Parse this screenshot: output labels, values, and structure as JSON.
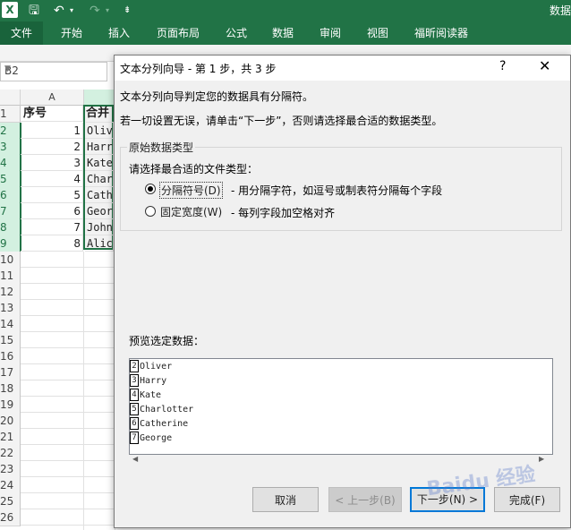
{
  "app": {
    "title_partial": "数据"
  },
  "ribbon": {
    "tabs": [
      "文件",
      "开始",
      "插入",
      "页面布局",
      "公式",
      "数据",
      "审阅",
      "视图",
      "福昕阅读器"
    ]
  },
  "name_box": {
    "value": "B2"
  },
  "sheet": {
    "columns": [
      "A"
    ],
    "row_numbers": [
      "1",
      "2",
      "3",
      "4",
      "5",
      "6",
      "7",
      "8",
      "9",
      "10",
      "11",
      "12",
      "13",
      "14",
      "15",
      "16",
      "17",
      "18",
      "19",
      "20",
      "21",
      "22",
      "23",
      "24",
      "25",
      "26"
    ],
    "header_a": "序号",
    "header_b": "合并",
    "col_a": [
      "1",
      "2",
      "3",
      "4",
      "5",
      "6",
      "7",
      "8"
    ],
    "col_b": [
      "Oliv",
      "Harr",
      "Kate",
      "Char",
      "Cath",
      "Geor",
      "John",
      "Alic"
    ]
  },
  "dialog": {
    "title": "文本分列向导 - 第 1 步，共 3 步",
    "help": "?",
    "close": "✕",
    "intro": "文本分列向导判定您的数据具有分隔符。",
    "hint": "若一切设置无误，请单击“下一步”，否则请选择最合适的数据类型。",
    "group_label": "原始数据类型",
    "prompt": "请选择最合适的文件类型：",
    "options": [
      {
        "label": "分隔符号(D)",
        "desc": "- 用分隔字符，如逗号或制表符分隔每个字段",
        "selected": true
      },
      {
        "label": "固定宽度(W)",
        "desc": "- 每列字段加空格对齐",
        "selected": false
      }
    ],
    "preview_label": "预览选定数据：",
    "preview_rows": [
      {
        "n": "2",
        "text": "Oliver"
      },
      {
        "n": "3",
        "text": "Harry"
      },
      {
        "n": "4",
        "text": "Kate"
      },
      {
        "n": "5",
        "text": "Charlotter"
      },
      {
        "n": "6",
        "text": "Catherine"
      },
      {
        "n": "7",
        "text": "George"
      }
    ],
    "buttons": {
      "cancel": "取消",
      "back": "< 上一步(B)",
      "next": "下一步(N) >",
      "finish": "完成(F)"
    }
  },
  "watermark": "Baidu 经验"
}
